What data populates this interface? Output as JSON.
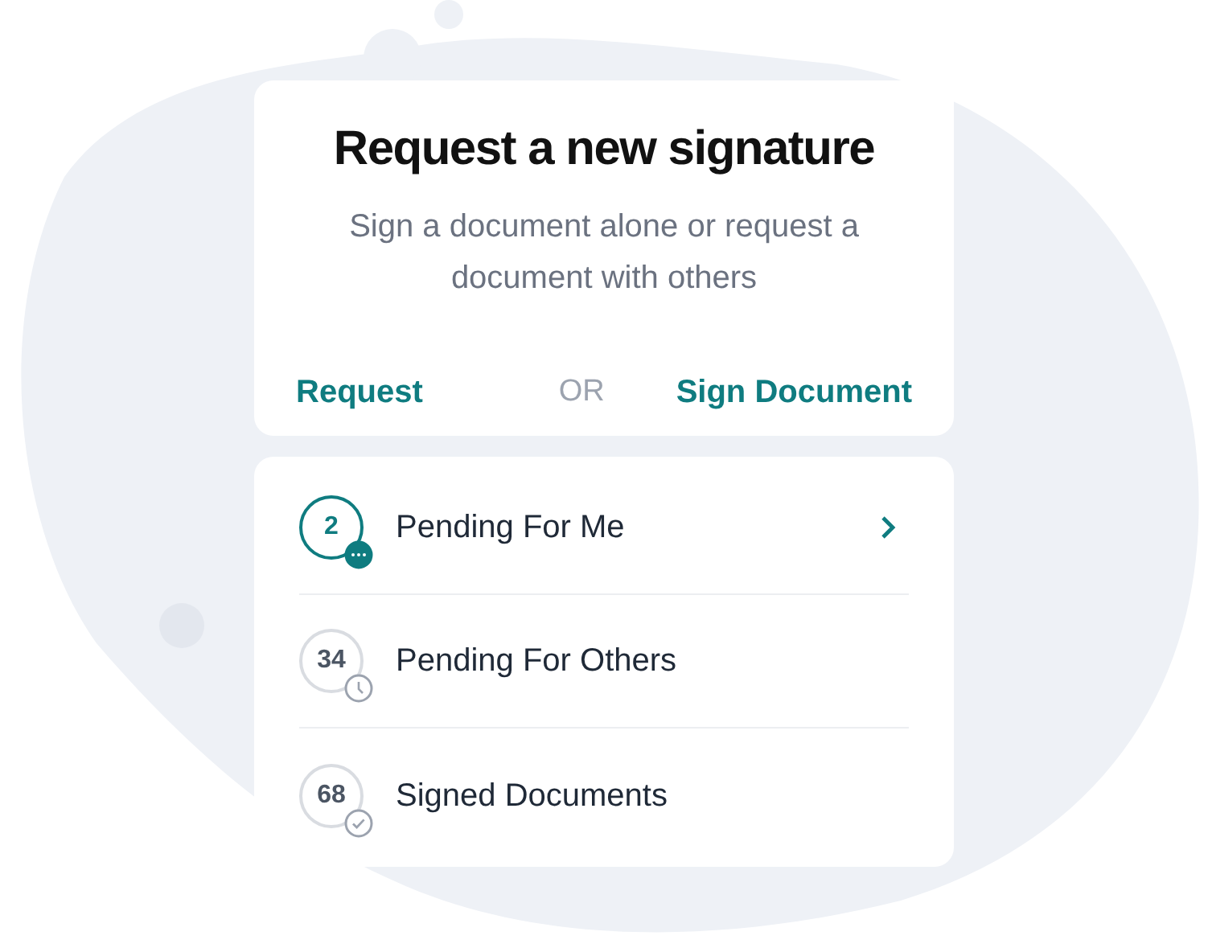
{
  "header": {
    "title": "Request a new signature",
    "subtitle": "Sign a document alone or request a document with others"
  },
  "actions": {
    "left": "Request",
    "separator": "OR",
    "right": "Sign Document"
  },
  "items": [
    {
      "count": "2",
      "label": "Pending For Me",
      "kind": "comments",
      "selected": true
    },
    {
      "count": "34",
      "label": "Pending For Others",
      "kind": "clock",
      "selected": false
    },
    {
      "count": "68",
      "label": "Signed Documents",
      "kind": "check",
      "selected": false
    }
  ]
}
